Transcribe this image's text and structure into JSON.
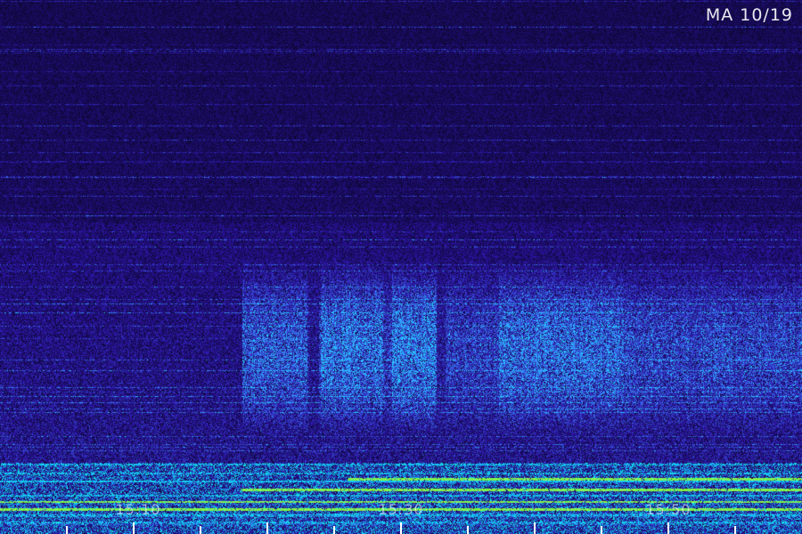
{
  "header": {
    "station_date": "MA 10/19"
  },
  "time_axis": {
    "labels": [
      "15:10",
      "15:30",
      "15:50"
    ]
  },
  "palette": {
    "background": "#050028",
    "noise_dark": "#1a0a5a",
    "noise_mid": "#2a2ad0",
    "activity_blue": "#3a6cff",
    "band_cyan": "#00e0ff",
    "band_green": "#7dff3a",
    "label_white": "#ffffff"
  }
}
